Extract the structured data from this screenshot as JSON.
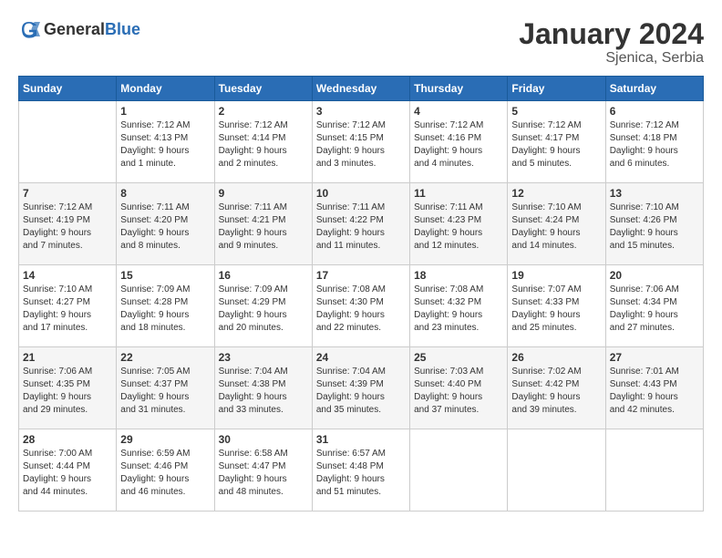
{
  "header": {
    "logo_general": "General",
    "logo_blue": "Blue",
    "month": "January 2024",
    "location": "Sjenica, Serbia"
  },
  "weekdays": [
    "Sunday",
    "Monday",
    "Tuesday",
    "Wednesday",
    "Thursday",
    "Friday",
    "Saturday"
  ],
  "weeks": [
    [
      {
        "day": "",
        "content": ""
      },
      {
        "day": "1",
        "content": "Sunrise: 7:12 AM\nSunset: 4:13 PM\nDaylight: 9 hours\nand 1 minute."
      },
      {
        "day": "2",
        "content": "Sunrise: 7:12 AM\nSunset: 4:14 PM\nDaylight: 9 hours\nand 2 minutes."
      },
      {
        "day": "3",
        "content": "Sunrise: 7:12 AM\nSunset: 4:15 PM\nDaylight: 9 hours\nand 3 minutes."
      },
      {
        "day": "4",
        "content": "Sunrise: 7:12 AM\nSunset: 4:16 PM\nDaylight: 9 hours\nand 4 minutes."
      },
      {
        "day": "5",
        "content": "Sunrise: 7:12 AM\nSunset: 4:17 PM\nDaylight: 9 hours\nand 5 minutes."
      },
      {
        "day": "6",
        "content": "Sunrise: 7:12 AM\nSunset: 4:18 PM\nDaylight: 9 hours\nand 6 minutes."
      }
    ],
    [
      {
        "day": "7",
        "content": "Sunrise: 7:12 AM\nSunset: 4:19 PM\nDaylight: 9 hours\nand 7 minutes."
      },
      {
        "day": "8",
        "content": "Sunrise: 7:11 AM\nSunset: 4:20 PM\nDaylight: 9 hours\nand 8 minutes."
      },
      {
        "day": "9",
        "content": "Sunrise: 7:11 AM\nSunset: 4:21 PM\nDaylight: 9 hours\nand 9 minutes."
      },
      {
        "day": "10",
        "content": "Sunrise: 7:11 AM\nSunset: 4:22 PM\nDaylight: 9 hours\nand 11 minutes."
      },
      {
        "day": "11",
        "content": "Sunrise: 7:11 AM\nSunset: 4:23 PM\nDaylight: 9 hours\nand 12 minutes."
      },
      {
        "day": "12",
        "content": "Sunrise: 7:10 AM\nSunset: 4:24 PM\nDaylight: 9 hours\nand 14 minutes."
      },
      {
        "day": "13",
        "content": "Sunrise: 7:10 AM\nSunset: 4:26 PM\nDaylight: 9 hours\nand 15 minutes."
      }
    ],
    [
      {
        "day": "14",
        "content": "Sunrise: 7:10 AM\nSunset: 4:27 PM\nDaylight: 9 hours\nand 17 minutes."
      },
      {
        "day": "15",
        "content": "Sunrise: 7:09 AM\nSunset: 4:28 PM\nDaylight: 9 hours\nand 18 minutes."
      },
      {
        "day": "16",
        "content": "Sunrise: 7:09 AM\nSunset: 4:29 PM\nDaylight: 9 hours\nand 20 minutes."
      },
      {
        "day": "17",
        "content": "Sunrise: 7:08 AM\nSunset: 4:30 PM\nDaylight: 9 hours\nand 22 minutes."
      },
      {
        "day": "18",
        "content": "Sunrise: 7:08 AM\nSunset: 4:32 PM\nDaylight: 9 hours\nand 23 minutes."
      },
      {
        "day": "19",
        "content": "Sunrise: 7:07 AM\nSunset: 4:33 PM\nDaylight: 9 hours\nand 25 minutes."
      },
      {
        "day": "20",
        "content": "Sunrise: 7:06 AM\nSunset: 4:34 PM\nDaylight: 9 hours\nand 27 minutes."
      }
    ],
    [
      {
        "day": "21",
        "content": "Sunrise: 7:06 AM\nSunset: 4:35 PM\nDaylight: 9 hours\nand 29 minutes."
      },
      {
        "day": "22",
        "content": "Sunrise: 7:05 AM\nSunset: 4:37 PM\nDaylight: 9 hours\nand 31 minutes."
      },
      {
        "day": "23",
        "content": "Sunrise: 7:04 AM\nSunset: 4:38 PM\nDaylight: 9 hours\nand 33 minutes."
      },
      {
        "day": "24",
        "content": "Sunrise: 7:04 AM\nSunset: 4:39 PM\nDaylight: 9 hours\nand 35 minutes."
      },
      {
        "day": "25",
        "content": "Sunrise: 7:03 AM\nSunset: 4:40 PM\nDaylight: 9 hours\nand 37 minutes."
      },
      {
        "day": "26",
        "content": "Sunrise: 7:02 AM\nSunset: 4:42 PM\nDaylight: 9 hours\nand 39 minutes."
      },
      {
        "day": "27",
        "content": "Sunrise: 7:01 AM\nSunset: 4:43 PM\nDaylight: 9 hours\nand 42 minutes."
      }
    ],
    [
      {
        "day": "28",
        "content": "Sunrise: 7:00 AM\nSunset: 4:44 PM\nDaylight: 9 hours\nand 44 minutes."
      },
      {
        "day": "29",
        "content": "Sunrise: 6:59 AM\nSunset: 4:46 PM\nDaylight: 9 hours\nand 46 minutes."
      },
      {
        "day": "30",
        "content": "Sunrise: 6:58 AM\nSunset: 4:47 PM\nDaylight: 9 hours\nand 48 minutes."
      },
      {
        "day": "31",
        "content": "Sunrise: 6:57 AM\nSunset: 4:48 PM\nDaylight: 9 hours\nand 51 minutes."
      },
      {
        "day": "",
        "content": ""
      },
      {
        "day": "",
        "content": ""
      },
      {
        "day": "",
        "content": ""
      }
    ]
  ]
}
